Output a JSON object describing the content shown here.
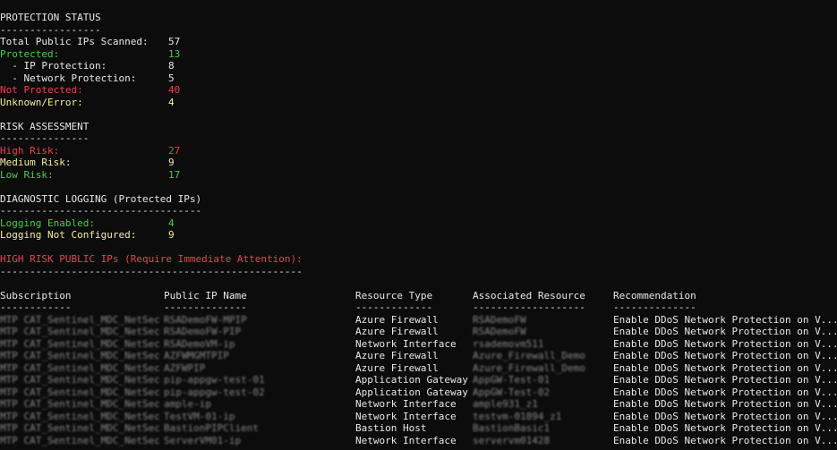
{
  "protection": {
    "header": "PROTECTION STATUS",
    "rule": "-----------------",
    "rows": [
      {
        "label": "Total Public IPs Scanned:",
        "value": "57",
        "color": "w"
      },
      {
        "label": "Protected:",
        "value": "13",
        "color": "g"
      },
      {
        "label": "  - IP Protection:",
        "value": "8",
        "color": "w"
      },
      {
        "label": "  - Network Protection:",
        "value": "5",
        "color": "w"
      },
      {
        "label": "Not Protected:",
        "value": "40",
        "color": "r"
      },
      {
        "label": "Unknown/Error:",
        "value": "4",
        "color": "y"
      }
    ]
  },
  "risk": {
    "header": "RISK ASSESSMENT",
    "rule": "---------------",
    "rows": [
      {
        "label": "High Risk:",
        "value": "27",
        "color": "r"
      },
      {
        "label": "Medium Risk:",
        "value": "9",
        "color": "y"
      },
      {
        "label": "Low Risk:",
        "value": "17",
        "color": "g"
      }
    ]
  },
  "logging": {
    "header": "DIAGNOSTIC LOGGING (Protected IPs)",
    "rule": "----------------------------------",
    "rows": [
      {
        "label": "Logging Enabled:",
        "value": "4",
        "color": "g"
      },
      {
        "label": "Logging Not Configured:",
        "value": "9",
        "color": "y"
      }
    ]
  },
  "high_risk": {
    "header": "HIGH RISK PUBLIC IPs (Require Immediate Attention):",
    "rule": "---------------------------------------------------",
    "columns": [
      "Subscription",
      "Public IP Name",
      "Resource Type",
      "Associated Resource",
      "Recommendation"
    ],
    "column_rules": [
      "------------",
      "--------------",
      "-------------",
      "-------------------",
      "--------------"
    ],
    "rows": [
      [
        "MTP CAT_Sentinel_MDC_NetSec",
        "RSADemoFW-MPIP",
        "Azure Firewall",
        "RSADemoFW",
        "Enable DDoS Network Protection on V..."
      ],
      [
        "MTP CAT_Sentinel_MDC_NetSec",
        "RSADemoFW-PIP",
        "Azure Firewall",
        "RSADemoFW",
        "Enable DDoS Network Protection on V..."
      ],
      [
        "MTP CAT_Sentinel_MDC_NetSec",
        "RSADemoVM-ip",
        "Network Interface",
        "rsademovm511",
        "Enable DDoS Network Protection on V..."
      ],
      [
        "MTP CAT_Sentinel_MDC_NetSec",
        "AZFWMGMTPIP",
        "Azure Firewall",
        "Azure_Firewall_Demo",
        "Enable DDoS Network Protection on V..."
      ],
      [
        "MTP CAT_Sentinel_MDC_NetSec",
        "AZFWPIP",
        "Azure Firewall",
        "Azure_Firewall_Demo",
        "Enable DDoS Network Protection on V..."
      ],
      [
        "MTP CAT_Sentinel_MDC_NetSec",
        "pip-appgw-test-01",
        "Application Gateway",
        "AppGW-Test-01",
        "Enable DDoS Network Protection on V..."
      ],
      [
        "MTP CAT_Sentinel_MDC_NetSec",
        "pip-appgw-test-02",
        "Application Gateway",
        "AppGW-Test-02",
        "Enable DDoS Network Protection on V..."
      ],
      [
        "MTP CAT_Sentinel_MDC_NetSec",
        "ample-ip",
        "Network Interface",
        "ample931_z1",
        "Enable DDoS Network Protection on V..."
      ],
      [
        "MTP CAT_Sentinel_MDC_NetSec",
        "TestVM-01-ip",
        "Network Interface",
        "testvm-01894_z1",
        "Enable DDoS Network Protection on V..."
      ],
      [
        "MTP CAT_Sentinel_MDC_NetSec",
        "BastionPIPClient",
        "Bastion Host",
        "BastionBasic1",
        "Enable DDoS Network Protection on V..."
      ],
      [
        "MTP CAT_Sentinel_MDC_NetSec",
        "ServerVM01-ip",
        "Network Interface",
        "servervm01428",
        "Enable DDoS Network Protection on V..."
      ]
    ]
  },
  "colors": {
    "background": "#0c0c0c",
    "text": "#e8e8e8",
    "green": "#4ec94e",
    "red": "#e8464e",
    "yellow": "#f2ee9e"
  }
}
